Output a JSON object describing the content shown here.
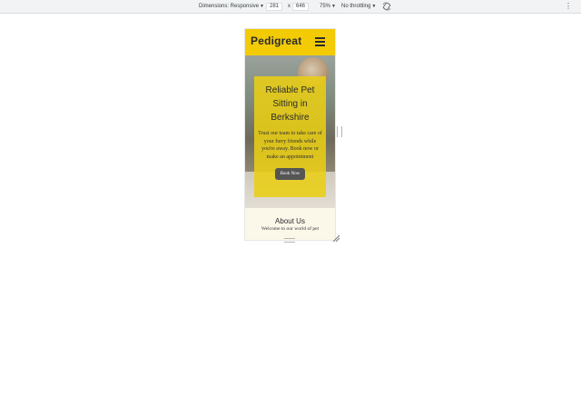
{
  "devtools": {
    "dimensions_label": "Dimensions: Responsive",
    "width_value": "281",
    "times_symbol": "x",
    "height_value": "646",
    "zoom_label": "75%",
    "throttle_label": "No throttling",
    "more_icon": "vertical-ellipsis-icon",
    "rotate_icon": "rotate-icon"
  },
  "site": {
    "brand": "Pedigreat",
    "menu_icon": "hamburger-icon",
    "hero": {
      "title": "Reliable Pet Sitting in Berkshire",
      "text": "Trust our team to take care of your furry friends while you're away. Book now or make an appointment",
      "button_label": "Book Now"
    },
    "about": {
      "title": "About Us",
      "text": "Welcome to our world of pet"
    },
    "colors": {
      "brand_yellow": "#f2cb05",
      "button_gray": "#555555"
    }
  }
}
